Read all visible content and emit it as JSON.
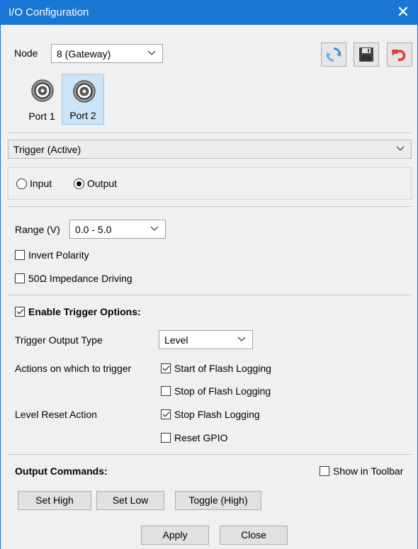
{
  "window": {
    "title": "I/O Configuration"
  },
  "node": {
    "label": "Node",
    "value": "8 (Gateway)"
  },
  "toolbar": {
    "refresh_icon": "refresh-icon",
    "save_icon": "save-icon",
    "undo_icon": "undo-icon"
  },
  "ports": [
    {
      "label": "Port 1",
      "selected": false
    },
    {
      "label": "Port 2",
      "selected": true
    }
  ],
  "mode_select": {
    "value": "Trigger (Active)"
  },
  "direction": {
    "input_label": "Input",
    "output_label": "Output",
    "selected": "Output"
  },
  "range": {
    "label": "Range (V)",
    "value": "0.0 - 5.0"
  },
  "invert_polarity": {
    "label": "Invert Polarity",
    "checked": false
  },
  "impedance": {
    "label": "50Ω Impedance Driving",
    "checked": false
  },
  "trigger_options": {
    "label": "Enable Trigger Options:",
    "checked": true,
    "output_type_label": "Trigger Output Type",
    "output_type_value": "Level",
    "actions_label": "Actions on which to trigger",
    "actions": [
      {
        "label": "Start of Flash Logging",
        "checked": true
      },
      {
        "label": "Stop of Flash Logging",
        "checked": false
      }
    ],
    "reset_label": "Level Reset Action",
    "reset_actions": [
      {
        "label": "Stop Flash Logging",
        "checked": true
      },
      {
        "label": "Reset GPIO",
        "checked": false
      }
    ]
  },
  "output_commands": {
    "label": "Output Commands:",
    "show_in_toolbar": {
      "label": "Show in Toolbar",
      "checked": false
    },
    "buttons": [
      "Set High",
      "Set Low",
      "Toggle (High)"
    ]
  },
  "footer": {
    "apply": "Apply",
    "close": "Close"
  }
}
